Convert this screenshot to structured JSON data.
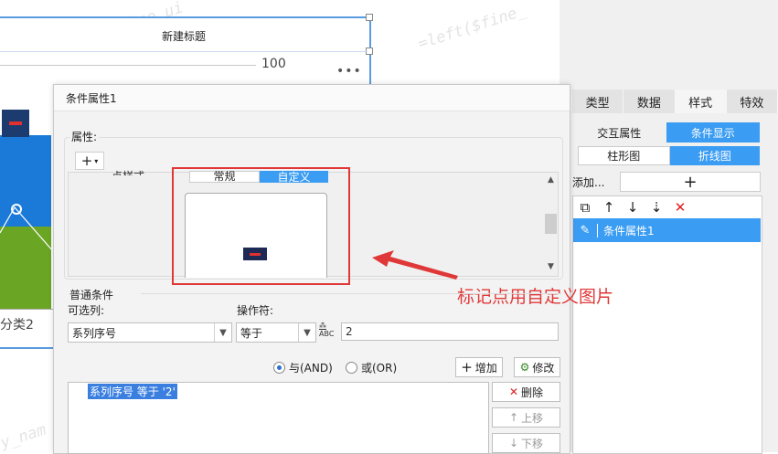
{
  "chart": {
    "title": "新建标题",
    "slider_value": "100",
    "more": "•••",
    "category_label": "分类2"
  },
  "watermarks": [
    "=left($fine_ui",
    "=left($fine_",
    "y_nam"
  ],
  "right_panel": {
    "tabs": [
      "类型",
      "数据",
      "样式",
      "特效"
    ],
    "active_tab": "样式",
    "sub_tabs": [
      "交互属性",
      "条件显示"
    ],
    "chart_type_tabs": [
      "柱形图",
      "折线图"
    ],
    "add_label": "添加...",
    "add_button": "+",
    "list_items": [
      "条件属性1"
    ]
  },
  "dialog": {
    "title": "条件属性1",
    "property_label": "属性:",
    "plus_button": "+",
    "cutoff_label": "点样式",
    "segment_tabs": [
      "常规",
      "自定义"
    ],
    "annotation": "标记点用自定义图片",
    "condition_section": "普通条件",
    "column_label": "可选列:",
    "operator_label": "操作符:",
    "column_value": "系列序号",
    "operator_value": "等于",
    "value_input": "2",
    "radio_and": "与(AND)",
    "radio_or": "或(OR)",
    "add_button": "增加",
    "edit_button": "修改",
    "delete_button": "删除",
    "up_button": "上移",
    "down_button": "下移",
    "condition_item": "系列序号 等于 '2'",
    "abc_icon_text": "ABC"
  },
  "colors": {
    "accent": "#3a9cf2",
    "annotation_red": "#e03838",
    "bar_blue": "#1b7ad8",
    "bar_green": "#6aa524"
  }
}
